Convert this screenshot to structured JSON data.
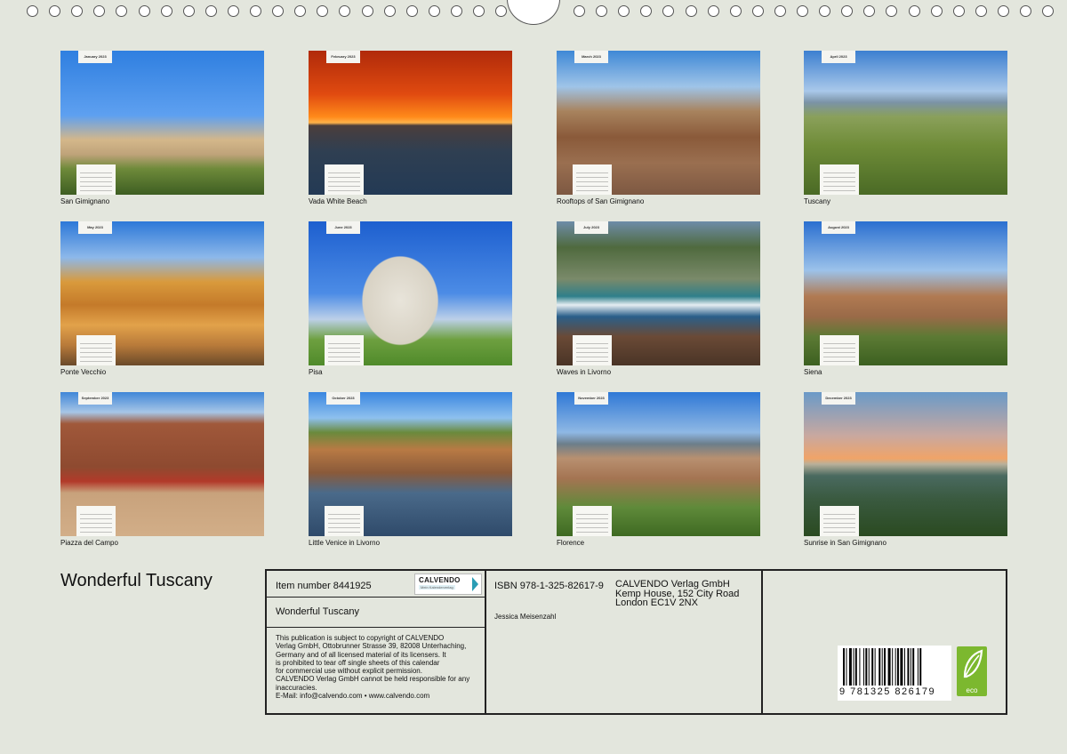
{
  "calendar": {
    "title": "Wonderful Tuscany",
    "months": [
      {
        "label": "January 2023",
        "caption": "San Gimignano"
      },
      {
        "label": "February 2023",
        "caption": "Vada White Beach"
      },
      {
        "label": "March 2023",
        "caption": "Rooftops of San Gimignano"
      },
      {
        "label": "April 2023",
        "caption": "Tuscany"
      },
      {
        "label": "May 2023",
        "caption": "Ponte Vecchio"
      },
      {
        "label": "June 2023",
        "caption": "Pisa"
      },
      {
        "label": "July 2023",
        "caption": "Waves in Livorno"
      },
      {
        "label": "August 2023",
        "caption": "Siena"
      },
      {
        "label": "September 2023",
        "caption": "Piazza del Campo"
      },
      {
        "label": "October 2023",
        "caption": "Little Venice in Livorno"
      },
      {
        "label": "November 2023",
        "caption": "Florence"
      },
      {
        "label": "December 2023",
        "caption": "Sunrise in San Gimignano"
      }
    ]
  },
  "info": {
    "item_number": "Item number 8441925",
    "title": "Wonderful Tuscany",
    "logo": {
      "name": "CALVENDO",
      "tagline": "Mein Kalenderverlag"
    },
    "legal_lines": [
      "This publication is subject to copyright of CALVENDO",
      "Verlag GmbH, Ottobrunner Strasse 39, 82008 Unterhaching,",
      "Germany and of all licensed material of its licensers. It",
      "is prohibited to tear off single sheets of this calendar",
      "for commercial use without explicit permission.",
      "CALVENDO Verlag GmbH cannot be held responsible for any",
      "inaccuracies.",
      "E-Mail: info@calvendo.com • www.calvendo.com"
    ],
    "isbn": "ISBN 978-1-325-82617-9",
    "author": "Jessica Meisenzahl",
    "publisher_lines": [
      "CALVENDO Verlag GmbH",
      "Kemp House, 152 City Road",
      "London EC1V 2NX"
    ],
    "barcode_number": "9 781325 826179",
    "eco_label": "eco"
  }
}
